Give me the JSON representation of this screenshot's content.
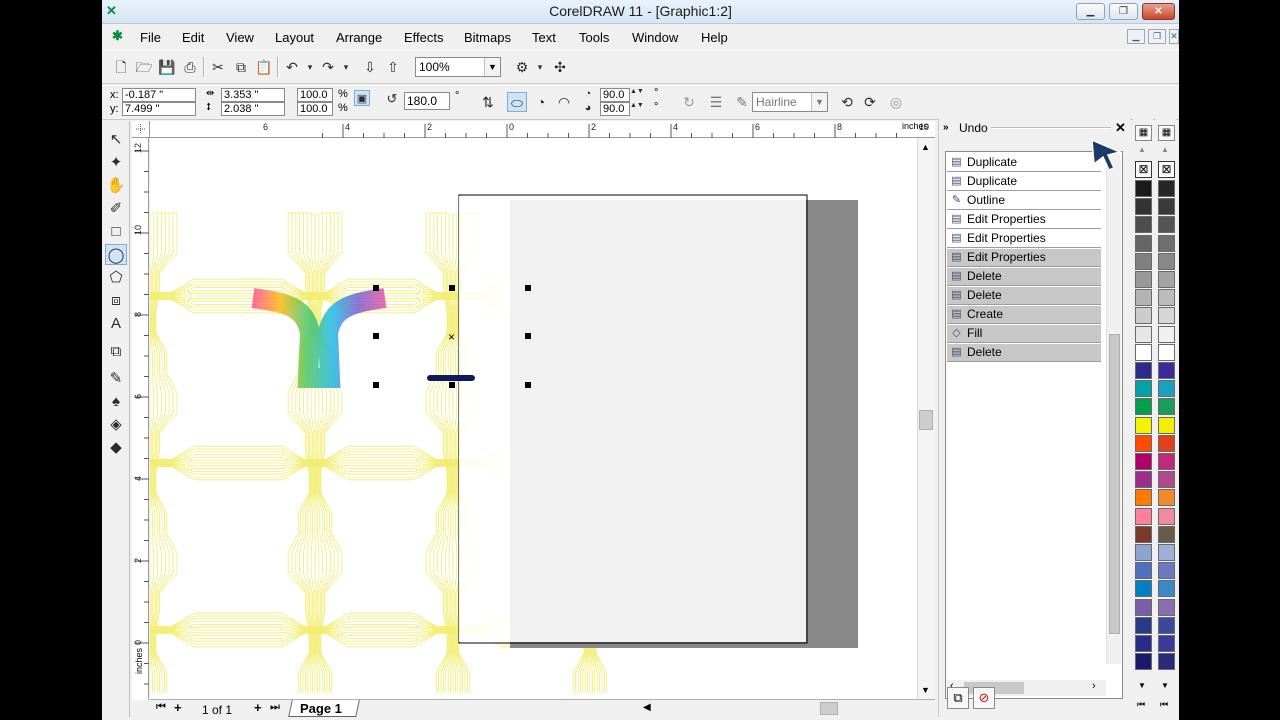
{
  "window": {
    "title": "CorelDRAW 11 - [Graphic1:2]",
    "app_icon": "coreldraw-icon"
  },
  "menu": [
    "File",
    "Edit",
    "View",
    "Layout",
    "Arrange",
    "Effects",
    "Bitmaps",
    "Text",
    "Tools",
    "Window",
    "Help"
  ],
  "standard_toolbar": {
    "zoom_value": "100%"
  },
  "property_bar": {
    "x_label": "x:",
    "x_value": "-0.187 \"",
    "y_label": "y:",
    "y_value": "7.499 \"",
    "width_value": "3.353 \"",
    "height_value": "2.038 \"",
    "scale_x": "100.0",
    "scale_y": "100.0",
    "percent": "%",
    "rotation": "180.0",
    "degree": "°",
    "arc_start": "90.0",
    "arc_end": "90.0",
    "outline_width": "Hairline"
  },
  "ruler": {
    "units": "inches",
    "h_labels": [
      "6",
      "4",
      "2",
      "0",
      "2",
      "4",
      "6",
      "8",
      "10"
    ],
    "v_labels": [
      "12",
      "10",
      "8",
      "6",
      "4",
      "2",
      "0"
    ]
  },
  "page_nav": {
    "page_count": "1 of 1",
    "page_tab": "Page 1"
  },
  "docker": {
    "title": "Undo",
    "items": [
      {
        "label": "Duplicate",
        "state": "done",
        "icon": "duplicate-icon"
      },
      {
        "label": "Duplicate",
        "state": "done",
        "icon": "duplicate-icon"
      },
      {
        "label": "Outline",
        "state": "done",
        "icon": "outline-pen-icon"
      },
      {
        "label": "Edit Properties",
        "state": "done",
        "icon": "properties-icon"
      },
      {
        "label": "Edit Properties",
        "state": "selected",
        "icon": "properties-icon"
      },
      {
        "label": "Edit Properties",
        "state": "undone",
        "icon": "properties-icon"
      },
      {
        "label": "Delete",
        "state": "undone",
        "icon": "delete-icon"
      },
      {
        "label": "Delete",
        "state": "undone",
        "icon": "delete-icon"
      },
      {
        "label": "Create",
        "state": "undone",
        "icon": "create-icon"
      },
      {
        "label": "Fill",
        "state": "undone",
        "icon": "fill-icon"
      },
      {
        "label": "Delete",
        "state": "undone",
        "icon": "delete-icon"
      }
    ]
  },
  "palette_colors": {
    "left": [
      "#ffffff",
      "#1a1a1a",
      "#333333",
      "#4d4d4d",
      "#666666",
      "#808080",
      "#999999",
      "#b3b3b3",
      "#cccccc",
      "#e6e6e6",
      "#ffffff",
      "#2e2a8c",
      "#00a3a3",
      "#00a04a",
      "#f4f400",
      "#ff4a00",
      "#b0006a",
      "#9c2f8a",
      "#ff7a00",
      "#ff7f9f",
      "#7a3a2a",
      "#8fa3d1",
      "#4f6fbf",
      "#0080c0",
      "#7a5fa8",
      "#2a3a8a",
      "#2a2a8a",
      "#1a1a6a"
    ],
    "right": [
      "#ffffff",
      "#262626",
      "#3a3a3a",
      "#555555",
      "#6e6e6e",
      "#888888",
      "#a3a3a3",
      "#bcbcbc",
      "#d6d6d6",
      "#f0f0f0",
      "#ffffff",
      "#3a2a9c",
      "#1aa0c0",
      "#1a9c5a",
      "#f0f000",
      "#e0401a",
      "#c02a7a",
      "#b04a8a",
      "#f08a2a",
      "#f08aa0",
      "#6a5a4a",
      "#a0b0d8",
      "#6a7ac0",
      "#3a8ac8",
      "#8a6fb0",
      "#3a4a9a",
      "#3a3a9a",
      "#2a2a7a"
    ]
  },
  "colors": {
    "selection": "#3399ff",
    "undone": "#c7c7c7",
    "pattern_yellow": "#f2ee73"
  }
}
